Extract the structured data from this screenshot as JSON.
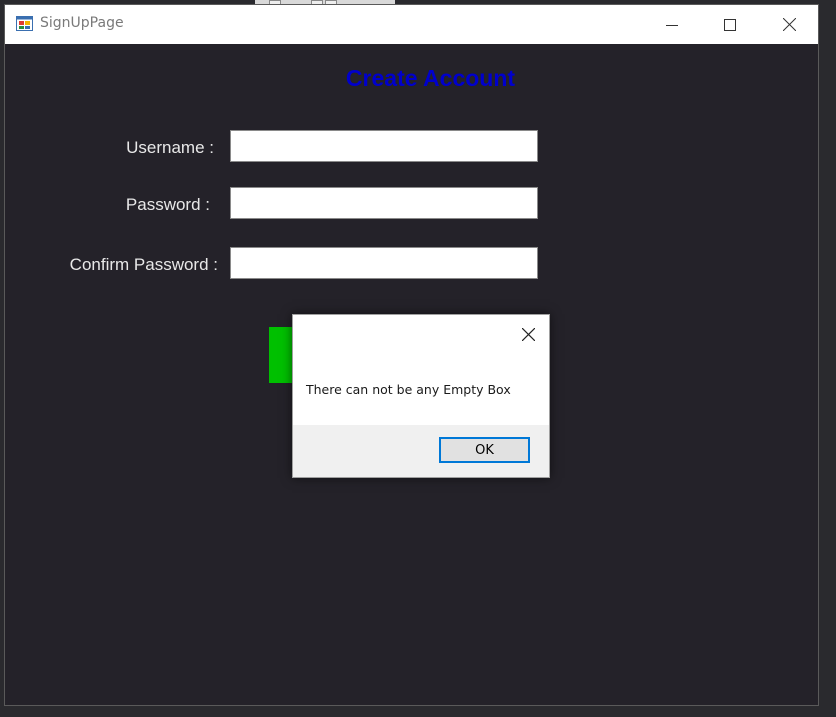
{
  "window": {
    "title": "SignUpPage",
    "icon": "winforms-app-icon",
    "controls": {
      "minimize": "minimize-icon",
      "maximize": "maximize-icon",
      "close": "close-icon"
    }
  },
  "form": {
    "heading": "Create Account",
    "fields": [
      {
        "label": "Username :",
        "value": ""
      },
      {
        "label": "Password :",
        "value": ""
      },
      {
        "label": "Confirm Password :",
        "value": ""
      }
    ],
    "submit_button_color": "#00c000",
    "heading_color": "#0000cc",
    "background_color": "#242229"
  },
  "dialog": {
    "message": "There can not be any Empty Box",
    "ok_label": "OK",
    "close_icon": "close-icon",
    "accent_color": "#0078d7"
  }
}
